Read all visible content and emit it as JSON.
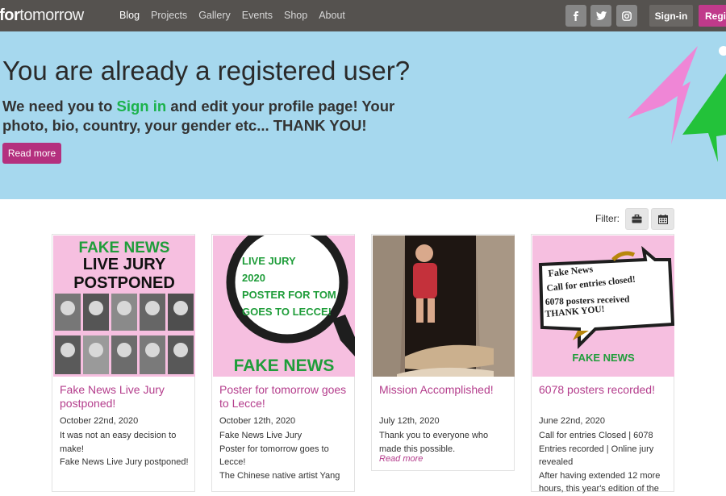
{
  "navbar": {
    "brand_bold": "ter for",
    "brand_thin": "tomorrow",
    "links": [
      "Blog",
      "Projects",
      "Gallery",
      "Events",
      "Shop",
      "About"
    ],
    "social": [
      "f",
      "t",
      "ig"
    ],
    "signin": "Sign-in",
    "register": "Regis"
  },
  "hero": {
    "title": "You are already a registered user?",
    "lead_before": "We need you to ",
    "lead_link": "Sign in",
    "lead_after": " and edit your profile page! Your photo, bio, country, your gender etc... THANK YOU!",
    "button": "Read more"
  },
  "filter": {
    "label": "Filter:"
  },
  "cards": [
    {
      "image_text": [
        "FAKE NEWS",
        "LIVE JURY",
        "POSTPONED"
      ],
      "title": "Fake News Live Jury postponed!",
      "date": "October 22nd, 2020",
      "body": "It was not an easy decision to make!\nFake News Live Jury postponed!"
    },
    {
      "image_text": [
        "LIVE JURY",
        "2020",
        "POSTER FOR TOM",
        "GOES TO LECCE!",
        "FAKE NEWS"
      ],
      "title": "Poster for tomorrow goes to Lecce!",
      "date": "October 12th, 2020",
      "body": "Fake News Live Jury\nPoster for tomorrow goes to Lecce!\nThe Chinese native artist Yang"
    },
    {
      "title": "Mission Accomplished!",
      "date": "July 12th, 2020",
      "body": "Thank you to everyone who made this possible.",
      "more": "Read more"
    },
    {
      "image_text": [
        "Fake News",
        "Call for entries closed!",
        "6078 posters received",
        "THANK YOU!",
        "FAKE NEWS"
      ],
      "title": "6078 posters recorded!",
      "date": "June 22nd, 2020",
      "body": "Call for entries Closed | 6078 Entries recorded | Online jury revealed\nAfter having extended 12 more hours, this year's edition of the"
    }
  ],
  "colors": {
    "navbar": "#55524f",
    "hero_bg": "#a6d8ee",
    "accent_magenta": "#b4307e",
    "green": "#1bb24b",
    "pink": "#f4a6d7"
  }
}
